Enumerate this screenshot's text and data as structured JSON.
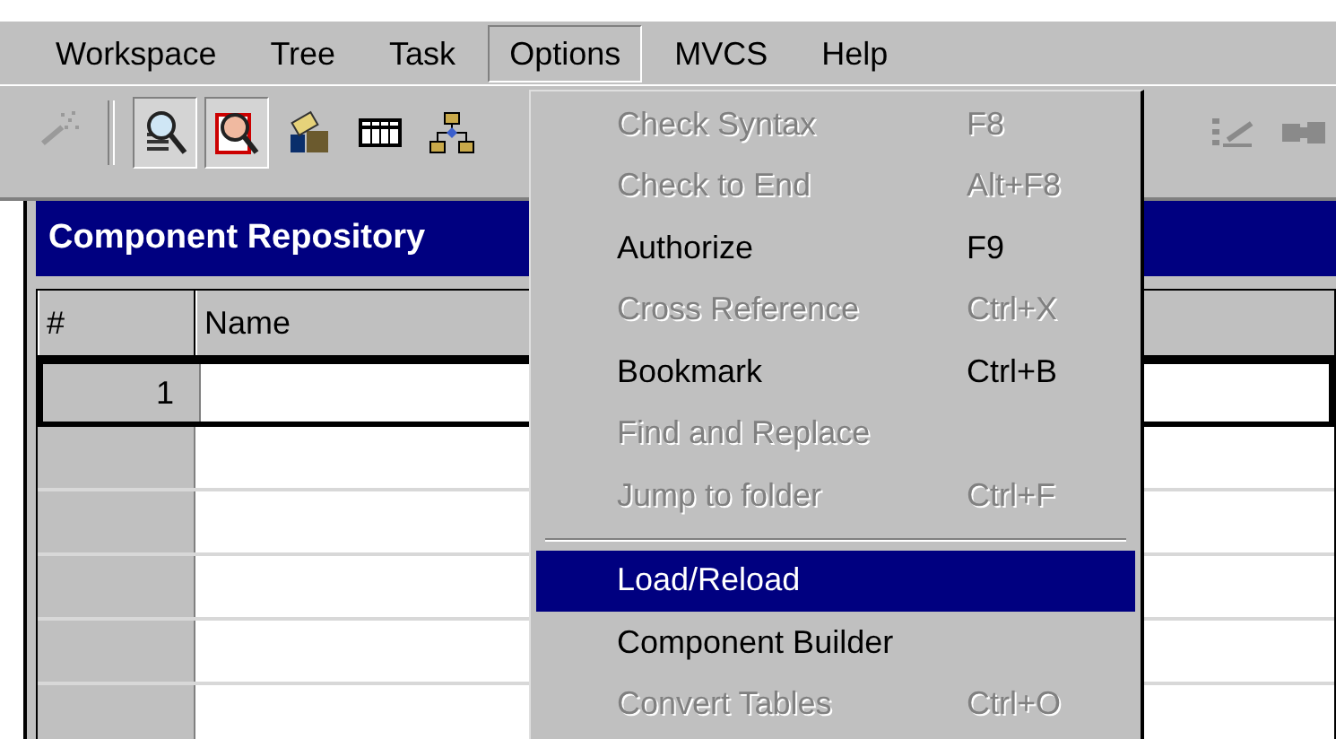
{
  "menu_bar": [
    {
      "label": "Workspace",
      "selected": false
    },
    {
      "label": "Tree",
      "selected": false
    },
    {
      "label": "Task",
      "selected": false
    },
    {
      "label": "Options",
      "selected": true
    },
    {
      "label": "MVCS",
      "selected": false
    },
    {
      "label": "Help",
      "selected": false
    }
  ],
  "toolbar": [
    {
      "kind": "wand",
      "disabled": true,
      "pressed": false
    },
    {
      "kind": "separator"
    },
    {
      "kind": "search-list",
      "pressed": true
    },
    {
      "kind": "search-doc",
      "pressed": true
    },
    {
      "kind": "shapes",
      "pressed": false
    },
    {
      "kind": "table",
      "pressed": false
    },
    {
      "kind": "hierarchy",
      "pressed": false
    }
  ],
  "toolbar_right": [
    {
      "kind": "edit-list",
      "disabled": true
    },
    {
      "kind": "plug",
      "disabled": true
    }
  ],
  "window": {
    "title": "Component Repository"
  },
  "table": {
    "columns": [
      "#",
      "Name"
    ],
    "rows": [
      {
        "number": "1",
        "current": true
      },
      {
        "current": false
      },
      {
        "current": false
      },
      {
        "current": false
      },
      {
        "current": false
      },
      {
        "current": false
      }
    ]
  },
  "options_menu": [
    {
      "kind": "item",
      "label": "Check Syntax",
      "shortcut": "F8",
      "disabled": true,
      "selected": false
    },
    {
      "kind": "item",
      "label": "Check to End",
      "shortcut": "Alt+F8",
      "disabled": true,
      "selected": false
    },
    {
      "kind": "item",
      "label": "Authorize",
      "shortcut": "F9",
      "disabled": false,
      "selected": false
    },
    {
      "kind": "item",
      "label": "Cross Reference",
      "shortcut": "Ctrl+X",
      "disabled": true,
      "selected": false
    },
    {
      "kind": "item",
      "label": "Bookmark",
      "shortcut": "Ctrl+B",
      "disabled": false,
      "selected": false
    },
    {
      "kind": "item",
      "label": "Find and Replace",
      "disabled": true,
      "selected": false
    },
    {
      "kind": "item",
      "label": "Jump to folder",
      "shortcut": "Ctrl+F",
      "disabled": true,
      "selected": false
    },
    {
      "kind": "separator"
    },
    {
      "kind": "item",
      "label": "Load/Reload",
      "disabled": false,
      "selected": true
    },
    {
      "kind": "item",
      "label": "Component Builder",
      "disabled": false,
      "selected": false
    },
    {
      "kind": "item",
      "label": "Convert Tables",
      "shortcut": "Ctrl+O",
      "disabled": true,
      "selected": false
    }
  ]
}
